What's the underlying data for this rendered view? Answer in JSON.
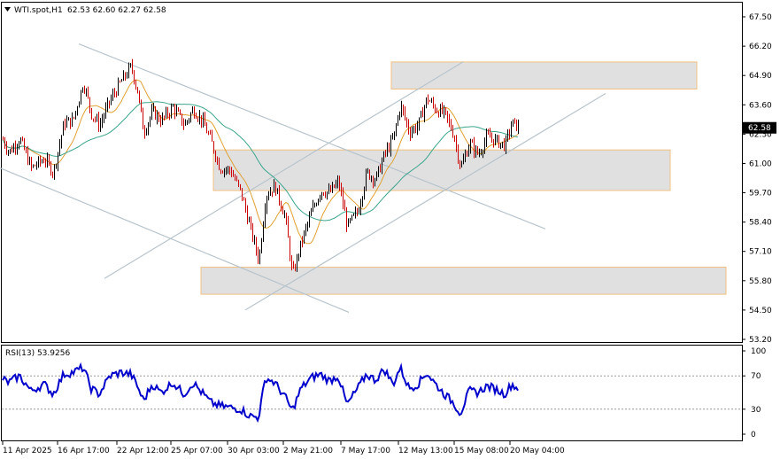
{
  "header": {
    "symbol_label": "WTI.spot,H1",
    "ohlc_text": "62.53 62.60 62.27 62.58"
  },
  "rsi_panel": {
    "label": "RSI(13) 53.9256",
    "levels": [
      70,
      30
    ],
    "axis_ticks": [
      "100",
      "70",
      "30",
      "0"
    ],
    "line_color": "#0000cc"
  },
  "colors": {
    "bull_candle": "#000000",
    "bear_candle": "#cc0000",
    "ma_fast": "#e0a030",
    "ma_slow": "#3aa58c",
    "trend_lines": "#b8c4cc",
    "zone_fill": "#e0e0e0",
    "zone_border": "#f0c080",
    "price_tag_bg": "#000000"
  },
  "chart_data": {
    "type": "candlestick",
    "y_ticks": [
      "67.50",
      "66.20",
      "64.90",
      "63.60",
      "62.30",
      "61.00",
      "59.70",
      "58.40",
      "57.10",
      "55.80",
      "54.50",
      "53.20"
    ],
    "y_range": [
      53.2,
      67.5
    ],
    "x_tick_labels": [
      "11 Apr 2025",
      "16 Apr 17:00",
      "22 Apr 12:00",
      "25 Apr 07:00",
      "30 Apr 03:00",
      "2 May 21:00",
      "7 May 17:00",
      "12 May 13:00",
      "15 May 08:00",
      "20 May 04:00"
    ],
    "last_price": "62.58",
    "price_path": [
      [
        0,
        62.3
      ],
      [
        10,
        61.5
      ],
      [
        22,
        62.1
      ],
      [
        35,
        60.8
      ],
      [
        50,
        61.2
      ],
      [
        60,
        60.6
      ],
      [
        72,
        62.8
      ],
      [
        82,
        62.9
      ],
      [
        94,
        64.6
      ],
      [
        103,
        63.2
      ],
      [
        112,
        62.7
      ],
      [
        124,
        63.8
      ],
      [
        136,
        64.6
      ],
      [
        148,
        65.3
      ],
      [
        155,
        64.2
      ],
      [
        162,
        62.4
      ],
      [
        172,
        63.3
      ],
      [
        182,
        62.9
      ],
      [
        195,
        63.5
      ],
      [
        208,
        62.7
      ],
      [
        218,
        63.4
      ],
      [
        228,
        62.9
      ],
      [
        238,
        62.0
      ],
      [
        248,
        60.8
      ],
      [
        260,
        60.7
      ],
      [
        272,
        59.7
      ],
      [
        282,
        58.2
      ],
      [
        292,
        56.7
      ],
      [
        300,
        59.6
      ],
      [
        310,
        60.0
      ],
      [
        322,
        58.6
      ],
      [
        330,
        56.0
      ],
      [
        340,
        57.5
      ],
      [
        352,
        58.9
      ],
      [
        362,
        59.8
      ],
      [
        372,
        59.7
      ],
      [
        382,
        60.2
      ],
      [
        392,
        58.2
      ],
      [
        404,
        58.9
      ],
      [
        414,
        60.6
      ],
      [
        424,
        60.3
      ],
      [
        434,
        61.4
      ],
      [
        444,
        62.1
      ],
      [
        452,
        63.6
      ],
      [
        462,
        62.4
      ],
      [
        472,
        62.7
      ],
      [
        482,
        63.9
      ],
      [
        492,
        63.4
      ],
      [
        502,
        63.2
      ],
      [
        512,
        62.3
      ],
      [
        520,
        60.8
      ],
      [
        530,
        61.9
      ],
      [
        540,
        61.4
      ],
      [
        550,
        62.2
      ],
      [
        560,
        62.0
      ],
      [
        570,
        61.8
      ],
      [
        578,
        62.8
      ],
      [
        586,
        62.6
      ]
    ],
    "zones": [
      {
        "from_x": 442,
        "to_x": 787,
        "top": 65.5,
        "bottom": 64.3
      },
      {
        "from_x": 241,
        "to_x": 757,
        "top": 61.6,
        "bottom": 59.8
      },
      {
        "from_x": 227,
        "to_x": 820,
        "top": 56.4,
        "bottom": 55.2
      }
    ],
    "trend_lines": [
      {
        "x1": 89,
        "y1": 66.3,
        "x2": 616,
        "y2": 58.1
      },
      {
        "x1": 0,
        "y1": 60.8,
        "x2": 394,
        "y2": 54.4
      },
      {
        "x1": 118,
        "y1": 55.9,
        "x2": 523,
        "y2": 65.5
      },
      {
        "x1": 277,
        "y1": 54.5,
        "x2": 684,
        "y2": 64.1
      }
    ],
    "rsi_path": [
      [
        0,
        68
      ],
      [
        10,
        62
      ],
      [
        22,
        70
      ],
      [
        35,
        52
      ],
      [
        50,
        60
      ],
      [
        60,
        48
      ],
      [
        72,
        72
      ],
      [
        82,
        74
      ],
      [
        94,
        80
      ],
      [
        103,
        55
      ],
      [
        112,
        48
      ],
      [
        124,
        70
      ],
      [
        136,
        74
      ],
      [
        148,
        72
      ],
      [
        155,
        58
      ],
      [
        162,
        40
      ],
      [
        172,
        60
      ],
      [
        182,
        50
      ],
      [
        195,
        62
      ],
      [
        208,
        48
      ],
      [
        218,
        62
      ],
      [
        228,
        50
      ],
      [
        238,
        38
      ],
      [
        248,
        34
      ],
      [
        260,
        32
      ],
      [
        272,
        30
      ],
      [
        282,
        22
      ],
      [
        292,
        20
      ],
      [
        300,
        68
      ],
      [
        310,
        62
      ],
      [
        322,
        45
      ],
      [
        330,
        28
      ],
      [
        340,
        55
      ],
      [
        352,
        68
      ],
      [
        362,
        72
      ],
      [
        372,
        64
      ],
      [
        382,
        70
      ],
      [
        392,
        35
      ],
      [
        404,
        55
      ],
      [
        414,
        72
      ],
      [
        424,
        65
      ],
      [
        434,
        78
      ],
      [
        444,
        60
      ],
      [
        452,
        80
      ],
      [
        462,
        55
      ],
      [
        472,
        60
      ],
      [
        482,
        74
      ],
      [
        492,
        60
      ],
      [
        502,
        48
      ],
      [
        512,
        38
      ],
      [
        520,
        25
      ],
      [
        530,
        52
      ],
      [
        540,
        50
      ],
      [
        550,
        58
      ],
      [
        560,
        54
      ],
      [
        570,
        48
      ],
      [
        578,
        60
      ],
      [
        586,
        54
      ]
    ]
  }
}
